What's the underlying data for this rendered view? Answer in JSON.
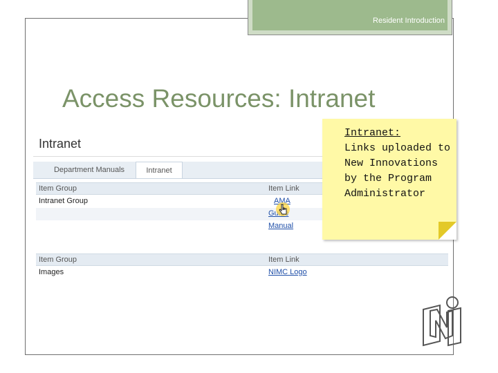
{
  "slide": {
    "header_text": "Resident Introduction",
    "title": "Access Resources: Intranet"
  },
  "screenshot": {
    "page_title": "Intranet",
    "tabs": [
      {
        "label": "Department Manuals",
        "active": false
      },
      {
        "label": "Intranet",
        "active": true
      }
    ],
    "group1": {
      "col_group": "Item Group",
      "col_link": "Item Link",
      "rows": [
        {
          "group": "Intranet Group",
          "link": "AMA"
        },
        {
          "group": "",
          "link": "Guide"
        },
        {
          "group": "",
          "link": "Manual"
        }
      ]
    },
    "group2": {
      "col_group": "Item Group",
      "col_link": "Item Link",
      "rows": [
        {
          "group": "Images",
          "link": "NIMC Logo"
        }
      ]
    }
  },
  "note": {
    "title": "Intranet:",
    "body": "Links uploaded to New Innovations by the Program Administrator"
  },
  "colors": {
    "accent_green": "#9dba8d",
    "title_green": "#7b9368",
    "note_yellow": "#fff9a6",
    "link_blue": "#1f4fa8"
  }
}
